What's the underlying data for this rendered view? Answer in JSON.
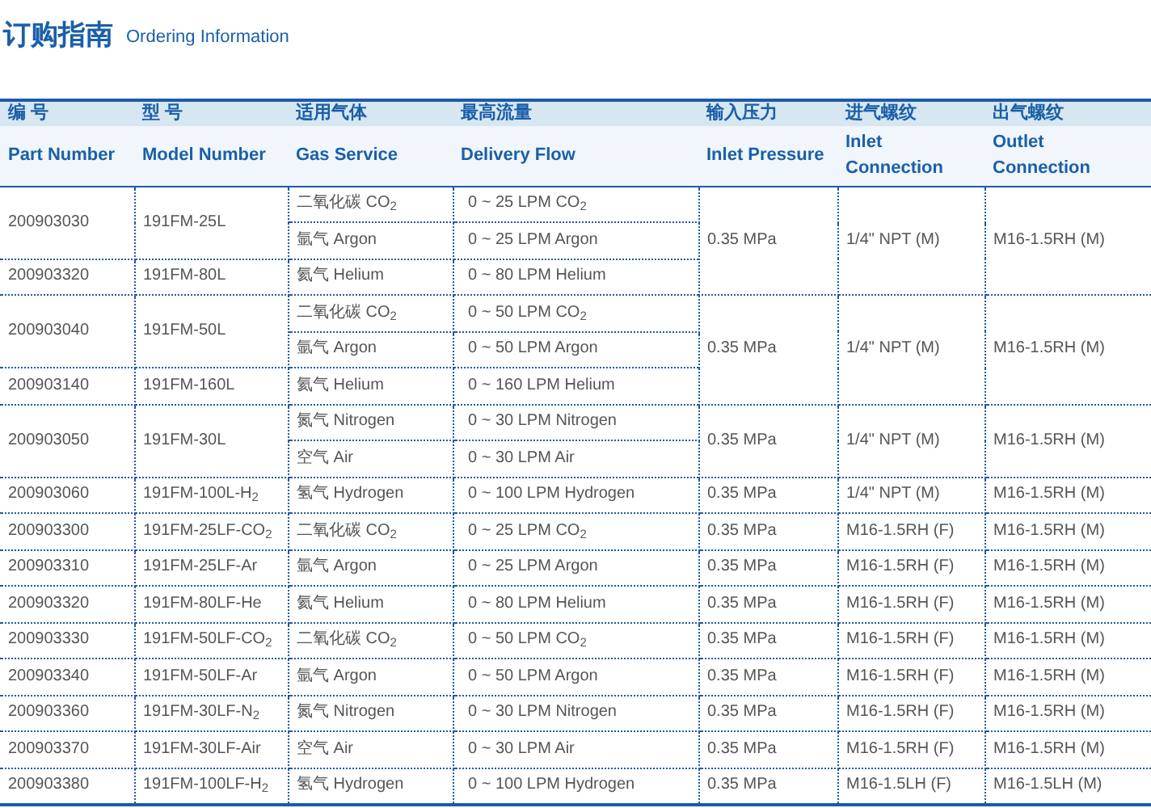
{
  "title": {
    "zh": "订购指南",
    "en": "Ordering Information"
  },
  "columns": [
    {
      "zh": "编 号",
      "en": "Part Number"
    },
    {
      "zh": "型 号",
      "en": "Model Number"
    },
    {
      "zh": "适用气体",
      "en": "Gas Service"
    },
    {
      "zh": "最高流量",
      "en": "Delivery Flow"
    },
    {
      "zh": "输入压力",
      "en": "Inlet Pressure"
    },
    {
      "zh": "进气螺纹",
      "en": "Inlet Connection"
    },
    {
      "zh": "出气螺纹",
      "en": "Outlet Connection"
    }
  ],
  "groups": [
    {
      "pressure": "0.35 MPa",
      "inlet": "1/4\" NPT (M)",
      "outlet": "M16-1.5RH (M)",
      "parts": [
        {
          "part": "200903030",
          "model": "191FM-25L",
          "gases": [
            {
              "gas": "二氧化碳 CO$_{2}$",
              "flow": "0 ~ 25 LPM CO$_{2}$"
            },
            {
              "gas": "氩气 Argon",
              "flow": "0 ~ 25 LPM Argon"
            }
          ]
        },
        {
          "part": "200903320",
          "model": "191FM-80L",
          "gases": [
            {
              "gas": "氦气 Helium",
              "flow": "0 ~ 80 LPM Helium"
            }
          ]
        }
      ]
    },
    {
      "pressure": "0.35 MPa",
      "inlet": "1/4\" NPT (M)",
      "outlet": "M16-1.5RH (M)",
      "parts": [
        {
          "part": "200903040",
          "model": "191FM-50L",
          "gases": [
            {
              "gas": "二氧化碳 CO$_{2}$",
              "flow": "0 ~ 50 LPM CO$_{2}$"
            },
            {
              "gas": "氩气 Argon",
              "flow": "0 ~ 50 LPM Argon"
            }
          ]
        },
        {
          "part": "200903140",
          "model": "191FM-160L",
          "gases": [
            {
              "gas": "氦气 Helium",
              "flow": "0 ~ 160 LPM Helium"
            }
          ]
        }
      ]
    },
    {
      "pressure": "0.35 MPa",
      "inlet": "1/4\" NPT (M)",
      "outlet": "M16-1.5RH (M)",
      "parts": [
        {
          "part": "200903050",
          "model": "191FM-30L",
          "gases": [
            {
              "gas": "氮气 Nitrogen",
              "flow": "0 ~ 30 LPM Nitrogen"
            },
            {
              "gas": "空气 Air",
              "flow": "0 ~ 30 LPM Air"
            }
          ]
        }
      ]
    },
    {
      "pressure": "0.35 MPa",
      "inlet": "1/4\" NPT (M)",
      "outlet": "M16-1.5RH (M)",
      "parts": [
        {
          "part": "200903060",
          "model": "191FM-100L-H$_{2}$",
          "gases": [
            {
              "gas": "氢气 Hydrogen",
              "flow": "0 ~ 100 LPM Hydrogen"
            }
          ]
        }
      ]
    },
    {
      "pressure": "0.35 MPa",
      "inlet": "M16-1.5RH (F)",
      "outlet": "M16-1.5RH (M)",
      "parts": [
        {
          "part": "200903300",
          "model": "191FM-25LF-CO$_{2}$",
          "gases": [
            {
              "gas": "二氧化碳 CO$_{2}$",
              "flow": "0 ~ 25 LPM CO$_{2}$"
            }
          ]
        }
      ]
    },
    {
      "pressure": "0.35 MPa",
      "inlet": "M16-1.5RH (F)",
      "outlet": "M16-1.5RH (M)",
      "parts": [
        {
          "part": "200903310",
          "model": "191FM-25LF-Ar",
          "gases": [
            {
              "gas": "氩气 Argon",
              "flow": "0 ~ 25 LPM Argon"
            }
          ]
        }
      ]
    },
    {
      "pressure": "0.35 MPa",
      "inlet": "M16-1.5RH (F)",
      "outlet": "M16-1.5RH (M)",
      "parts": [
        {
          "part": "200903320",
          "model": "191FM-80LF-He",
          "gases": [
            {
              "gas": "氦气 Helium",
              "flow": "0 ~ 80 LPM Helium"
            }
          ]
        }
      ]
    },
    {
      "pressure": "0.35 MPa",
      "inlet": "M16-1.5RH (F)",
      "outlet": "M16-1.5RH (M)",
      "parts": [
        {
          "part": "200903330",
          "model": "191FM-50LF-CO$_{2}$",
          "gases": [
            {
              "gas": "二氧化碳 CO$_{2}$",
              "flow": "0 ~ 50 LPM CO$_{2}$"
            }
          ]
        }
      ]
    },
    {
      "pressure": "0.35 MPa",
      "inlet": "M16-1.5RH (F)",
      "outlet": "M16-1.5RH (M)",
      "parts": [
        {
          "part": "200903340",
          "model": "191FM-50LF-Ar",
          "gases": [
            {
              "gas": "氩气 Argon",
              "flow": "0 ~ 50 LPM Argon"
            }
          ]
        }
      ]
    },
    {
      "pressure": "0.35 MPa",
      "inlet": "M16-1.5RH (F)",
      "outlet": "M16-1.5RH (M)",
      "parts": [
        {
          "part": "200903360",
          "model": "191FM-30LF-N$_{2}$",
          "gases": [
            {
              "gas": "氮气 Nitrogen",
              "flow": "0 ~ 30 LPM Nitrogen"
            }
          ]
        }
      ]
    },
    {
      "pressure": "0.35 MPa",
      "inlet": "M16-1.5RH (F)",
      "outlet": "M16-1.5RH (M)",
      "parts": [
        {
          "part": "200903370",
          "model": "191FM-30LF-Air",
          "gases": [
            {
              "gas": "空气 Air",
              "flow": "0 ~ 30 LPM Air"
            }
          ]
        }
      ]
    },
    {
      "pressure": "0.35 MPa",
      "inlet": "M16-1.5LH (F)",
      "outlet": "M16-1.5LH (M)",
      "parts": [
        {
          "part": "200903380",
          "model": "191FM-100LF-H$_{2}$",
          "gases": [
            {
              "gas": "氢气 Hydrogen",
              "flow": "0 ~ 100 LPM Hydrogen"
            }
          ]
        }
      ]
    }
  ]
}
